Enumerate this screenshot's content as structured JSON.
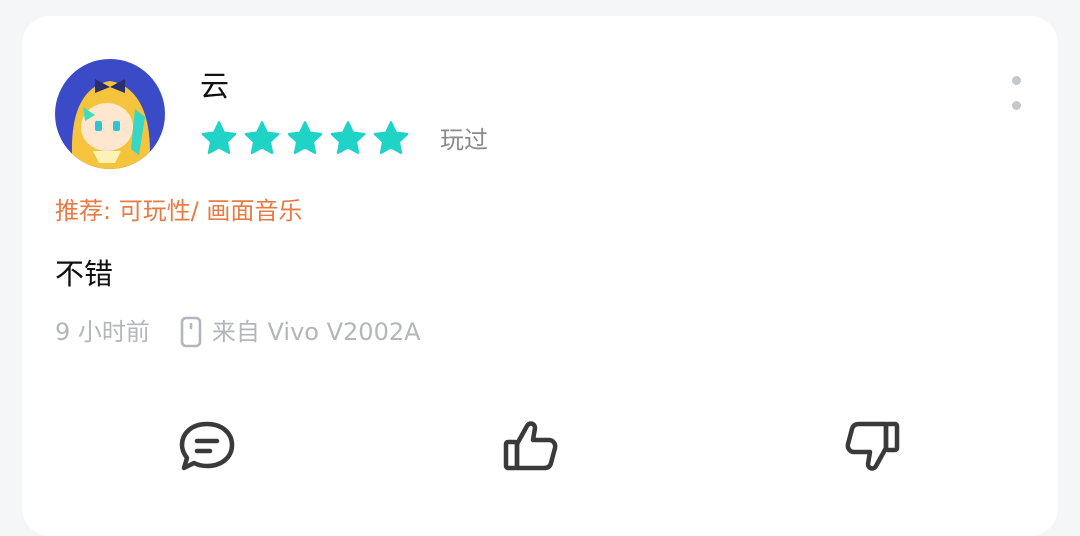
{
  "review": {
    "username": "云",
    "rating": 5,
    "played_label": "玩过",
    "recommend": "推荐: 可玩性/ 画面音乐",
    "content": "不错",
    "time": "9 小时前",
    "device": "来自 Vivo V2002A"
  },
  "icons": {
    "more": "more-vertical-icon",
    "device": "phone-icon",
    "comment": "comment-icon",
    "like": "thumbs-up-icon",
    "dislike": "thumbs-down-icon"
  },
  "colors": {
    "star": "#1fd3c6",
    "recommend": "#e77b43",
    "meta": "#b3b6bb",
    "icon": "#3a3a3a"
  }
}
